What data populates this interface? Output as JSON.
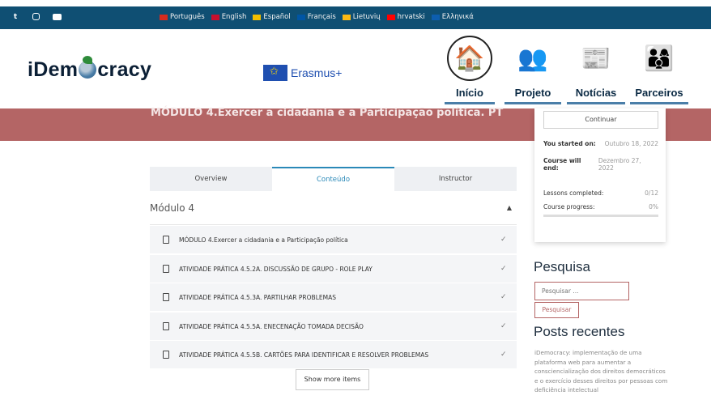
{
  "topbar": {
    "social": [
      "twitter-icon",
      "instagram-icon",
      "youtube-icon"
    ],
    "languages": [
      {
        "label": "Português",
        "flag": "#d52b1e"
      },
      {
        "label": "English",
        "flag": "#c8102e"
      },
      {
        "label": "Español",
        "flag": "#f1bf00"
      },
      {
        "label": "Français",
        "flag": "#0055a4"
      },
      {
        "label": "Lietuvių",
        "flag": "#fdb913"
      },
      {
        "label": "hrvatski",
        "flag": "#ff0000"
      },
      {
        "label": "Ελληνικά",
        "flag": "#0d5eaf"
      }
    ]
  },
  "header": {
    "logo_left": "iDem",
    "logo_right": "cracy",
    "erasmus": "Erasmus+",
    "nav": [
      {
        "label": "Início",
        "icon": "house-icon"
      },
      {
        "label": "Projeto",
        "icon": "team-meeting-icon"
      },
      {
        "label": "Notícias",
        "icon": "newspaper-icon"
      },
      {
        "label": "Parceiros",
        "icon": "partners-icon"
      }
    ]
  },
  "banner": {
    "title": "MÓDULO 4.Exercer a cidadania e a Participação política. PT"
  },
  "course_card": {
    "continue_label": "Continuar",
    "started_label": "You started on:",
    "started_value": "Outubro 18, 2022",
    "end_label": "Course will end:",
    "end_value": "Dezembro 27, 2022",
    "lessons_label": "Lessons completed:",
    "lessons_value": "0/12",
    "progress_label": "Course progress:",
    "progress_value": "0%",
    "progress": 0
  },
  "tabs": [
    "Overview",
    "Conteúdo",
    "Instructor"
  ],
  "module": {
    "name": "Módulo 4",
    "lessons": [
      "MÓDULO 4.Exercer a cidadania e a Participação política",
      "ATIVIDADE PRÁTICA 4.5.2A. DISCUSSÃO DE GRUPO - ROLE PLAY",
      "ATIVIDADE PRÁTICA 4.5.3A. PARTILHAR PROBLEMAS",
      "ATIVIDADE PRÁTICA 4.5.5A. ENECENAÇÃO TOMADA DECISÃO",
      "ATIVIDADE PRÁTICA 4.5.5B. CARTÕES PARA IDENTIFICAR E RESOLVER PROBLEMAS"
    ],
    "show_more": "Show more items"
  },
  "search": {
    "heading": "Pesquisa",
    "placeholder": "Pesquisar ...",
    "button": "Pesquisar"
  },
  "recent": {
    "heading": "Posts recentes",
    "post": "iDemocracy: implementação de uma plataforma web para aumentar a consciencialização dos direitos democráticos e o exercício desses direitos por pessoas com deficiência intelectual"
  }
}
